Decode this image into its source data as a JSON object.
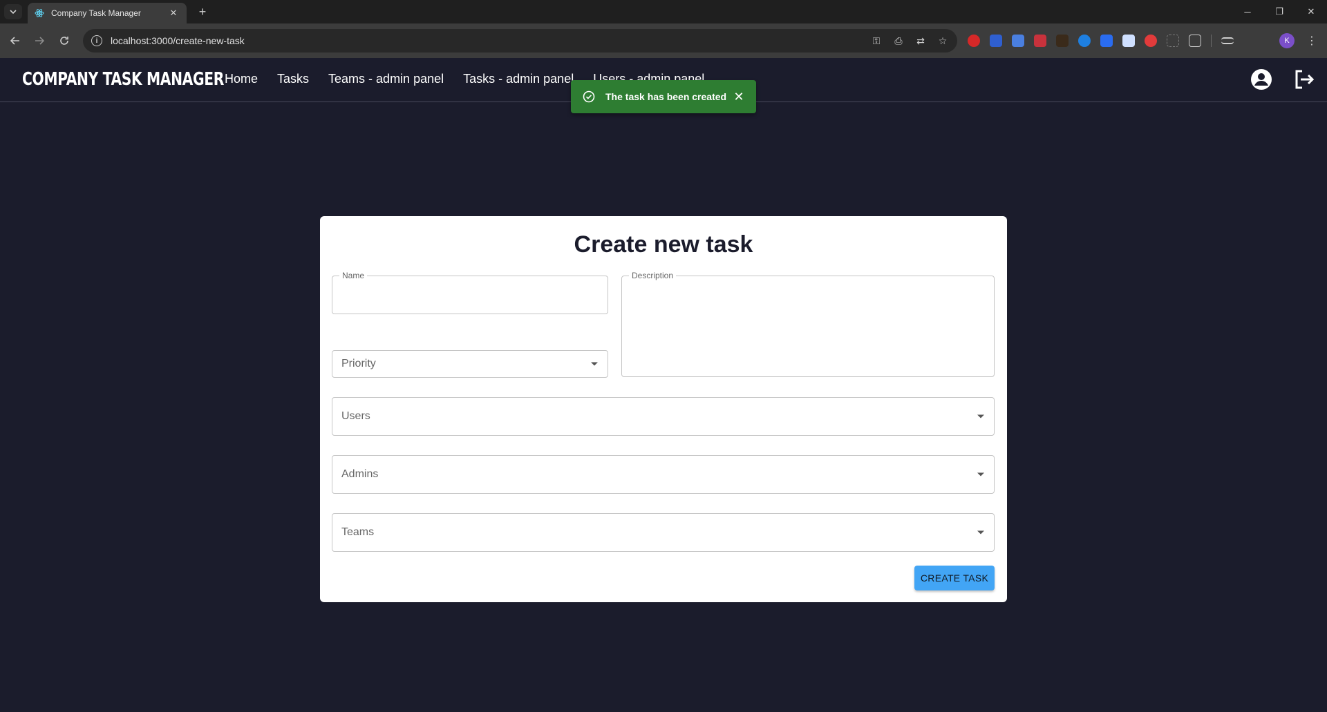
{
  "browser": {
    "tab_title": "Company Task Manager",
    "url": "localhost:3000/create-new-task",
    "profile_initial": "K"
  },
  "app": {
    "brand": "COMPANY TASK MANAGER",
    "nav": [
      "Home",
      "Tasks",
      "Teams - admin panel",
      "Tasks - admin panel",
      "Users - admin panel"
    ]
  },
  "toast": {
    "message": "The task has been created",
    "color": "#2e7d32"
  },
  "form": {
    "title": "Create new task",
    "name_label": "Name",
    "name_value": "",
    "description_label": "Description",
    "description_value": "",
    "priority_placeholder": "Priority",
    "users_placeholder": "Users",
    "admins_placeholder": "Admins",
    "teams_placeholder": "Teams",
    "submit_label": "CREATE TASK"
  },
  "colors": {
    "background": "#1b1c2c",
    "card": "#ffffff",
    "button": "#42a5f5"
  }
}
